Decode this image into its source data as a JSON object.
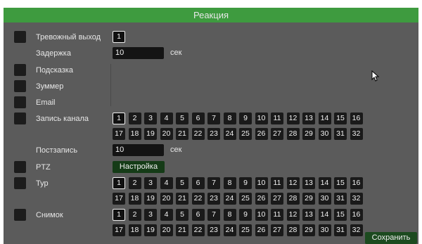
{
  "title": "Реакция",
  "rows": {
    "alarm_out": {
      "label": "Тревожный выход",
      "value": "1"
    },
    "delay": {
      "label": "Задержка",
      "value": "10",
      "unit": "сек"
    },
    "hint": {
      "label": "Подсказка"
    },
    "buzzer": {
      "label": "Зуммер"
    },
    "email": {
      "label": "Email"
    },
    "channel_rec": {
      "label": "Запись канала"
    },
    "post_rec": {
      "label": "Постзапись",
      "value": "10",
      "unit": "сек"
    },
    "ptz": {
      "label": "PTZ",
      "button": "Настройка"
    },
    "tour": {
      "label": "Тур"
    },
    "snapshot": {
      "label": "Снимок"
    }
  },
  "channels": [
    "1",
    "2",
    "3",
    "4",
    "5",
    "6",
    "7",
    "8",
    "9",
    "10",
    "11",
    "12",
    "13",
    "14",
    "15",
    "16",
    "17",
    "18",
    "19",
    "20",
    "21",
    "22",
    "23",
    "24",
    "25",
    "26",
    "27",
    "28",
    "29",
    "30",
    "31",
    "32"
  ],
  "save_label": "Сохранить",
  "icons": {
    "cursor": "mouse-pointer-icon"
  },
  "colors": {
    "title_bar": "#3e9b3f",
    "panel": "#5b5b5b",
    "cell": "#1a1a1a"
  }
}
